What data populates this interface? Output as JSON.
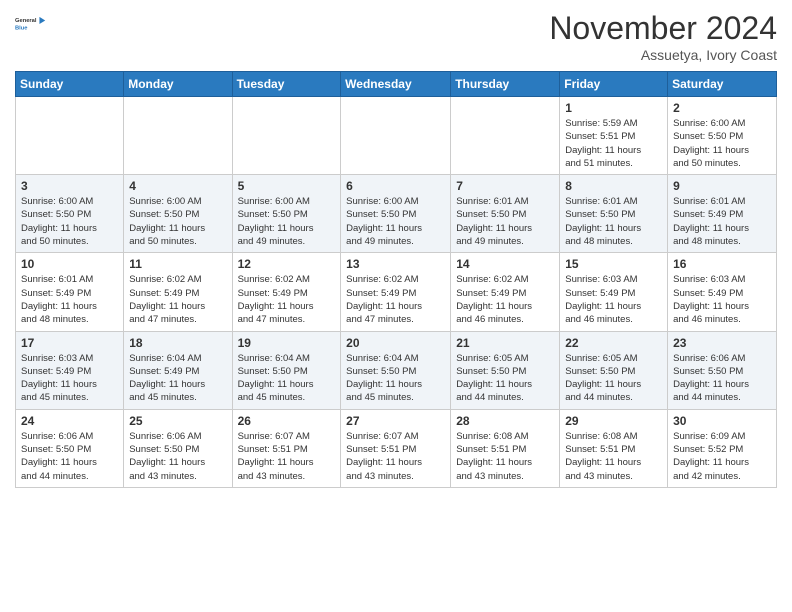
{
  "header": {
    "logo_line1": "General",
    "logo_line2": "Blue",
    "month": "November 2024",
    "location": "Assuetya, Ivory Coast"
  },
  "weekdays": [
    "Sunday",
    "Monday",
    "Tuesday",
    "Wednesday",
    "Thursday",
    "Friday",
    "Saturday"
  ],
  "weeks": [
    [
      {
        "day": "",
        "info": ""
      },
      {
        "day": "",
        "info": ""
      },
      {
        "day": "",
        "info": ""
      },
      {
        "day": "",
        "info": ""
      },
      {
        "day": "",
        "info": ""
      },
      {
        "day": "1",
        "info": "Sunrise: 5:59 AM\nSunset: 5:51 PM\nDaylight: 11 hours\nand 51 minutes."
      },
      {
        "day": "2",
        "info": "Sunrise: 6:00 AM\nSunset: 5:50 PM\nDaylight: 11 hours\nand 50 minutes."
      }
    ],
    [
      {
        "day": "3",
        "info": "Sunrise: 6:00 AM\nSunset: 5:50 PM\nDaylight: 11 hours\nand 50 minutes."
      },
      {
        "day": "4",
        "info": "Sunrise: 6:00 AM\nSunset: 5:50 PM\nDaylight: 11 hours\nand 50 minutes."
      },
      {
        "day": "5",
        "info": "Sunrise: 6:00 AM\nSunset: 5:50 PM\nDaylight: 11 hours\nand 49 minutes."
      },
      {
        "day": "6",
        "info": "Sunrise: 6:00 AM\nSunset: 5:50 PM\nDaylight: 11 hours\nand 49 minutes."
      },
      {
        "day": "7",
        "info": "Sunrise: 6:01 AM\nSunset: 5:50 PM\nDaylight: 11 hours\nand 49 minutes."
      },
      {
        "day": "8",
        "info": "Sunrise: 6:01 AM\nSunset: 5:50 PM\nDaylight: 11 hours\nand 48 minutes."
      },
      {
        "day": "9",
        "info": "Sunrise: 6:01 AM\nSunset: 5:49 PM\nDaylight: 11 hours\nand 48 minutes."
      }
    ],
    [
      {
        "day": "10",
        "info": "Sunrise: 6:01 AM\nSunset: 5:49 PM\nDaylight: 11 hours\nand 48 minutes."
      },
      {
        "day": "11",
        "info": "Sunrise: 6:02 AM\nSunset: 5:49 PM\nDaylight: 11 hours\nand 47 minutes."
      },
      {
        "day": "12",
        "info": "Sunrise: 6:02 AM\nSunset: 5:49 PM\nDaylight: 11 hours\nand 47 minutes."
      },
      {
        "day": "13",
        "info": "Sunrise: 6:02 AM\nSunset: 5:49 PM\nDaylight: 11 hours\nand 47 minutes."
      },
      {
        "day": "14",
        "info": "Sunrise: 6:02 AM\nSunset: 5:49 PM\nDaylight: 11 hours\nand 46 minutes."
      },
      {
        "day": "15",
        "info": "Sunrise: 6:03 AM\nSunset: 5:49 PM\nDaylight: 11 hours\nand 46 minutes."
      },
      {
        "day": "16",
        "info": "Sunrise: 6:03 AM\nSunset: 5:49 PM\nDaylight: 11 hours\nand 46 minutes."
      }
    ],
    [
      {
        "day": "17",
        "info": "Sunrise: 6:03 AM\nSunset: 5:49 PM\nDaylight: 11 hours\nand 45 minutes."
      },
      {
        "day": "18",
        "info": "Sunrise: 6:04 AM\nSunset: 5:49 PM\nDaylight: 11 hours\nand 45 minutes."
      },
      {
        "day": "19",
        "info": "Sunrise: 6:04 AM\nSunset: 5:50 PM\nDaylight: 11 hours\nand 45 minutes."
      },
      {
        "day": "20",
        "info": "Sunrise: 6:04 AM\nSunset: 5:50 PM\nDaylight: 11 hours\nand 45 minutes."
      },
      {
        "day": "21",
        "info": "Sunrise: 6:05 AM\nSunset: 5:50 PM\nDaylight: 11 hours\nand 44 minutes."
      },
      {
        "day": "22",
        "info": "Sunrise: 6:05 AM\nSunset: 5:50 PM\nDaylight: 11 hours\nand 44 minutes."
      },
      {
        "day": "23",
        "info": "Sunrise: 6:06 AM\nSunset: 5:50 PM\nDaylight: 11 hours\nand 44 minutes."
      }
    ],
    [
      {
        "day": "24",
        "info": "Sunrise: 6:06 AM\nSunset: 5:50 PM\nDaylight: 11 hours\nand 44 minutes."
      },
      {
        "day": "25",
        "info": "Sunrise: 6:06 AM\nSunset: 5:50 PM\nDaylight: 11 hours\nand 43 minutes."
      },
      {
        "day": "26",
        "info": "Sunrise: 6:07 AM\nSunset: 5:51 PM\nDaylight: 11 hours\nand 43 minutes."
      },
      {
        "day": "27",
        "info": "Sunrise: 6:07 AM\nSunset: 5:51 PM\nDaylight: 11 hours\nand 43 minutes."
      },
      {
        "day": "28",
        "info": "Sunrise: 6:08 AM\nSunset: 5:51 PM\nDaylight: 11 hours\nand 43 minutes."
      },
      {
        "day": "29",
        "info": "Sunrise: 6:08 AM\nSunset: 5:51 PM\nDaylight: 11 hours\nand 43 minutes."
      },
      {
        "day": "30",
        "info": "Sunrise: 6:09 AM\nSunset: 5:52 PM\nDaylight: 11 hours\nand 42 minutes."
      }
    ]
  ]
}
